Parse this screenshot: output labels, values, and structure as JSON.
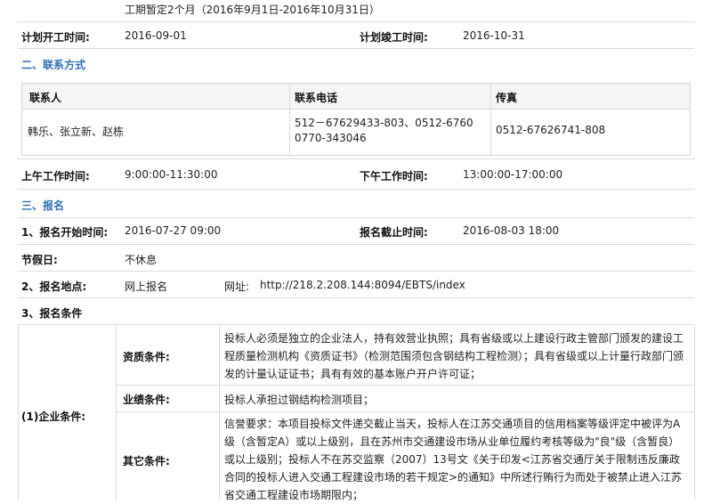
{
  "top_note": "工期暂定2个月（2016年9月1日-2016年10月31日）",
  "plan": {
    "start_label": "计划开工时间:",
    "start_value": "2016-09-01",
    "end_label": "计划竣工时间:",
    "end_value": "2016-10-31"
  },
  "section2": {
    "title": "二、联系方式"
  },
  "contact_table": {
    "headers": [
      "联系人",
      "联系电话",
      "传真"
    ],
    "person": "韩乐、张立新、赵栋",
    "phone_line1": "512－67629433-803、0512-6760",
    "phone_line2": "0770-343046",
    "fax": "0512-67626741-808"
  },
  "work_hours": {
    "am_label": "上午工作时间:",
    "am_value": "9:00:00-11:30:00",
    "pm_label": "下午工作时间:",
    "pm_value": "13:00:00-17:00:00"
  },
  "section3": {
    "title": "三、报名"
  },
  "registration": {
    "start_label": "1、报名开始时间:",
    "start_value": "2016-07-27 09:00",
    "end_label": "报名截止时间:",
    "end_value": "2016-08-03 18:00",
    "holiday_label": "节假日:",
    "holiday_value": "不休息",
    "location_label": "2、报名地点:",
    "location_value": "网上报名",
    "url_label": "网址:",
    "url_value": "http://218.2.208.144:8094/EBTS/index",
    "conditions_label": "3、报名条件"
  },
  "enterprise": {
    "label": "(1)企业条件:",
    "qual_label": "资质条件:",
    "qual_text": "投标人必须是独立的企业法人，持有效营业执照；具有省级或以上建设行政主管部门颁发的建设工程质量检测机构《资质证书》（检测范围须包含钢结构工程检测）；具有省级或以上计量行政部门颁发的计量认证证书；具有有效的基本账户开户许可证；",
    "perf_label": "业绩条件:",
    "perf_text": "投标人承担过钢结构检测项目；",
    "other_label": "其它条件:",
    "other_text": "信誉要求：本项目投标文件递交截止当天，投标人在江苏交通项目的信用档案等级评定中被评为A级（含暂定A）或以上级别，且在苏州市交通建设市场从业单位履约考核等级为\"良\"级（含暂良）或以上级别；投标人不在苏交监察（2007）13号文《关于印发<江苏省交通厅关于限制违反廉政合同的投标人进入交通工程建设市场的若干规定>的通知》中所述行贿行为而处于被禁止进入江苏省交通工程建设市场期限内；"
  }
}
